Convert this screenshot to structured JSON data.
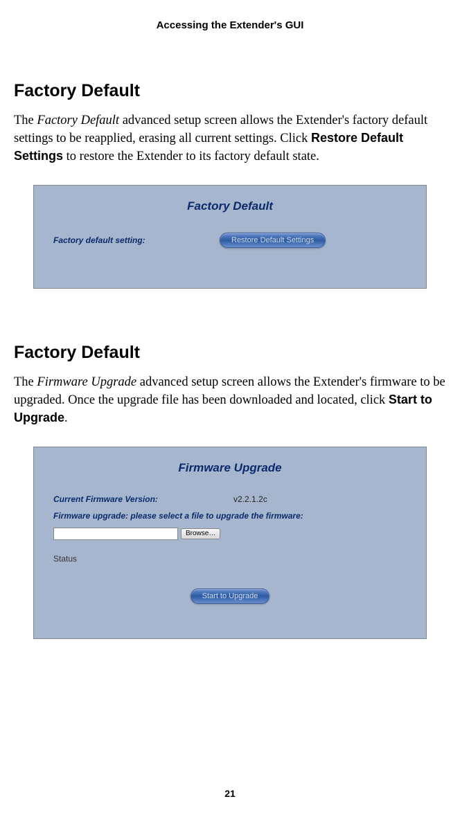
{
  "header": "Accessing the Extender's GUI",
  "section1": {
    "heading": "Factory Default",
    "para_pre": "The ",
    "para_italic": "Factory Default",
    "para_mid": " advanced setup screen allows the Extender's factory default settings to be reapplied, erasing all current settings. Click ",
    "para_bold": "Restore Default Settings",
    "para_post": " to restore the Extender to its factory default state.",
    "panel_title": "Factory Default",
    "panel_label": "Factory default setting:",
    "panel_button": "Restore Default Settings"
  },
  "section2": {
    "heading": "Factory Default",
    "para_pre": "The ",
    "para_italic": "Firmware Upgrade",
    "para_mid": " advanced setup screen allows the Extender's firmware to be upgraded. Once the upgrade file has been downloaded and located, click ",
    "para_bold": "Start to Upgrade",
    "para_post": ".",
    "panel_title": "Firmware Upgrade",
    "fw_label": "Current Firmware Version:",
    "fw_value": "v2.2.1.2c",
    "fw_instr": "Firmware upgrade: please select a file to upgrade the firmware:",
    "file_value": "",
    "browse_label": "Browse…",
    "status_label": "Status",
    "upgrade_button": "Start to Upgrade"
  },
  "page_number": "21"
}
